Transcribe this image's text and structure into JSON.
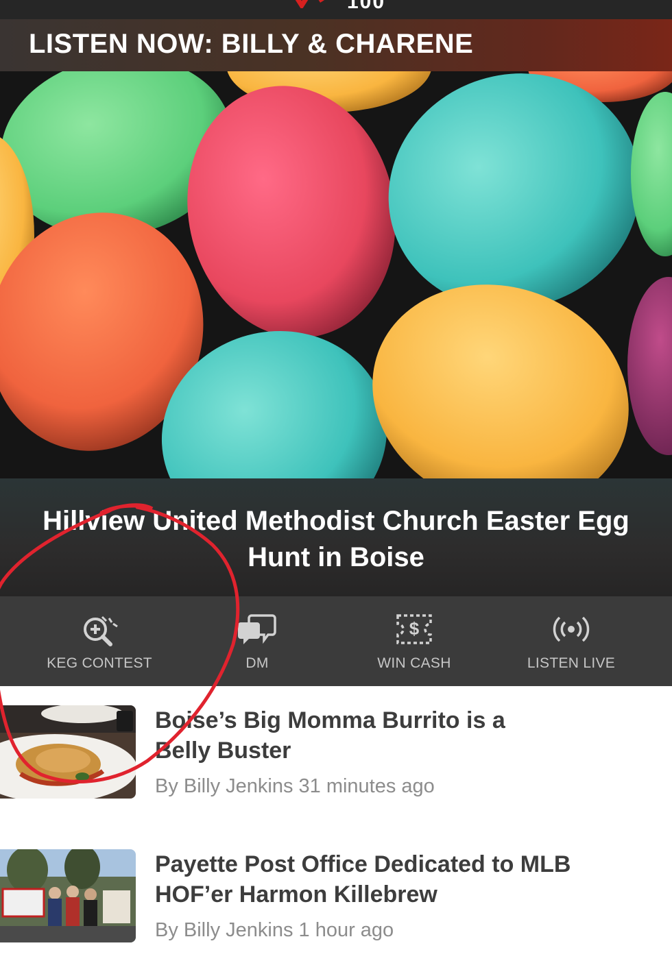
{
  "header": {
    "logo_text": "100",
    "brand_color": "#d6201f"
  },
  "banner": {
    "text": "LISTEN NOW: BILLY & CHARENE"
  },
  "carousel": {
    "slide_count": 6,
    "active_index": 0,
    "caption": "Hillview United Methodist Church Easter Egg Hunt in Boise"
  },
  "tabs": [
    {
      "label": "KEG CONTEST",
      "icon": "magnify-plus-icon"
    },
    {
      "label": "DM",
      "icon": "chat-bubbles-icon"
    },
    {
      "label": "WIN CASH",
      "icon": "dollar-ticket-icon"
    },
    {
      "label": "LISTEN LIVE",
      "icon": "broadcast-icon"
    }
  ],
  "articles": [
    {
      "title_line1": "Boise’s Big Momma Burrito is a",
      "title_line2": "Belly Buster",
      "byline": "By Billy Jenkins 31 minutes ago"
    },
    {
      "title_line1": "Payette Post Office Dedicated to MLB",
      "title_line2": "HOF’er Harmon Killebrew",
      "byline": "By Billy Jenkins 1 hour ago"
    }
  ],
  "colors": {
    "tab_bar": "#3b3b3b",
    "tab_label": "#c6c6c6",
    "annotation": "#e0232e"
  }
}
